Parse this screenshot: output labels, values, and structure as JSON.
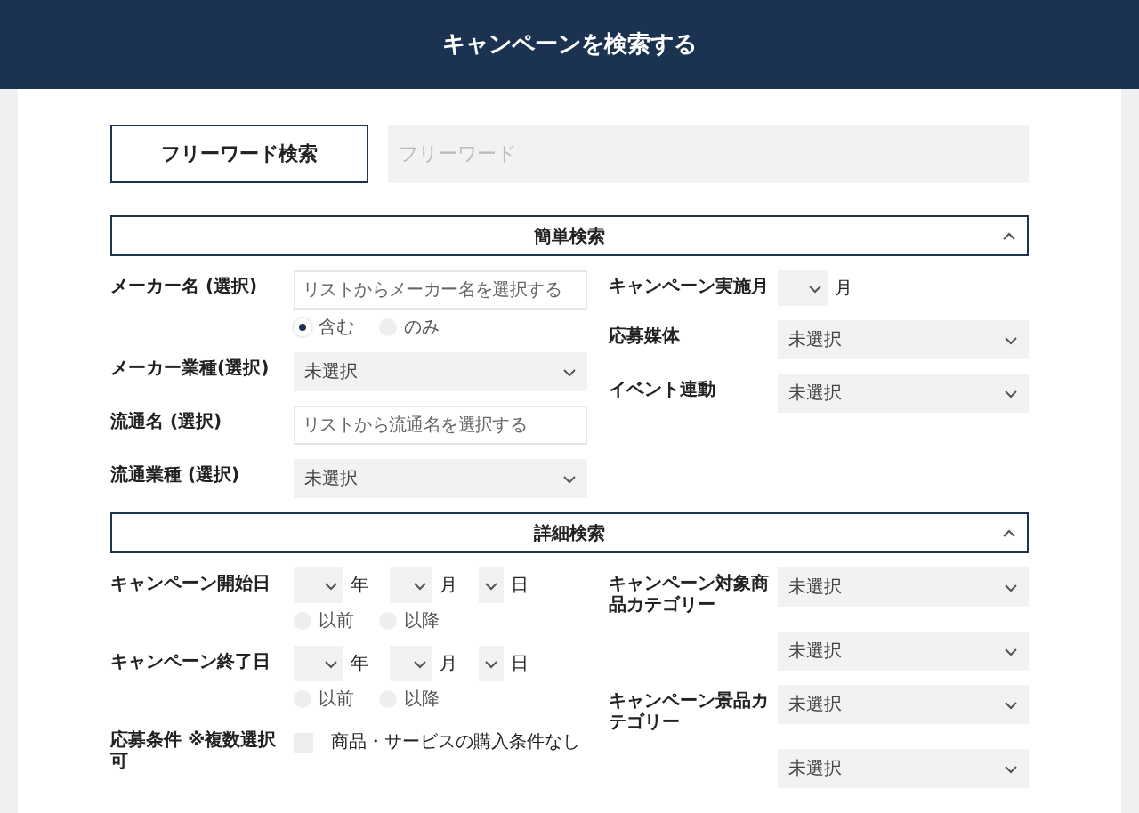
{
  "header": {
    "title": "キャンペーンを検索する"
  },
  "freeword": {
    "button": "フリーワード検索",
    "placeholder": "フリーワード"
  },
  "sections": [
    {
      "title": "簡単検索",
      "expanded": true,
      "left": [
        {
          "kind": "search",
          "label": "メーカー名 (選択)",
          "placeholder": "リストからメーカー名を選択する",
          "radios": [
            {
              "label": "含む",
              "selected": true
            },
            {
              "label": "のみ",
              "selected": false
            }
          ]
        },
        {
          "kind": "select",
          "label": "メーカー業種(選択)",
          "value": "未選択"
        },
        {
          "kind": "search",
          "label": "流通名 (選択)",
          "placeholder": "リストから流通名を選択する"
        },
        {
          "kind": "select",
          "label": "流通業種 (選択)",
          "value": "未選択"
        }
      ],
      "right": [
        {
          "kind": "month",
          "label": "キャンペーン実施月",
          "unit": "月"
        },
        {
          "kind": "select",
          "label": "応募媒体",
          "value": "未選択"
        },
        {
          "kind": "select",
          "label": "イベント連動",
          "value": "未選択"
        }
      ]
    },
    {
      "title": "詳細検索",
      "expanded": true,
      "left": [
        {
          "kind": "date",
          "label": "キャンペーン開始日",
          "units": [
            "年",
            "月",
            "日"
          ],
          "radios": [
            {
              "label": "以前",
              "selected": false
            },
            {
              "label": "以降",
              "selected": false
            }
          ]
        },
        {
          "kind": "date",
          "label": "キャンペーン終了日",
          "units": [
            "年",
            "月",
            "日"
          ],
          "radios": [
            {
              "label": "以前",
              "selected": false
            },
            {
              "label": "以降",
              "selected": false
            }
          ]
        },
        {
          "kind": "checkbox",
          "label": "応募条件 ※複数選択可",
          "option": "商品・サービスの購入条件なし",
          "checked": false
        }
      ],
      "right": [
        {
          "kind": "select",
          "label": "キャンペーン対象商品カテゴリー",
          "value": "未選択"
        },
        {
          "kind": "select",
          "value": "未選択"
        },
        {
          "kind": "select",
          "label": "キャンペーン景品カテゴリー",
          "value": "未選択"
        },
        {
          "kind": "select",
          "value": "未選択"
        }
      ]
    }
  ]
}
